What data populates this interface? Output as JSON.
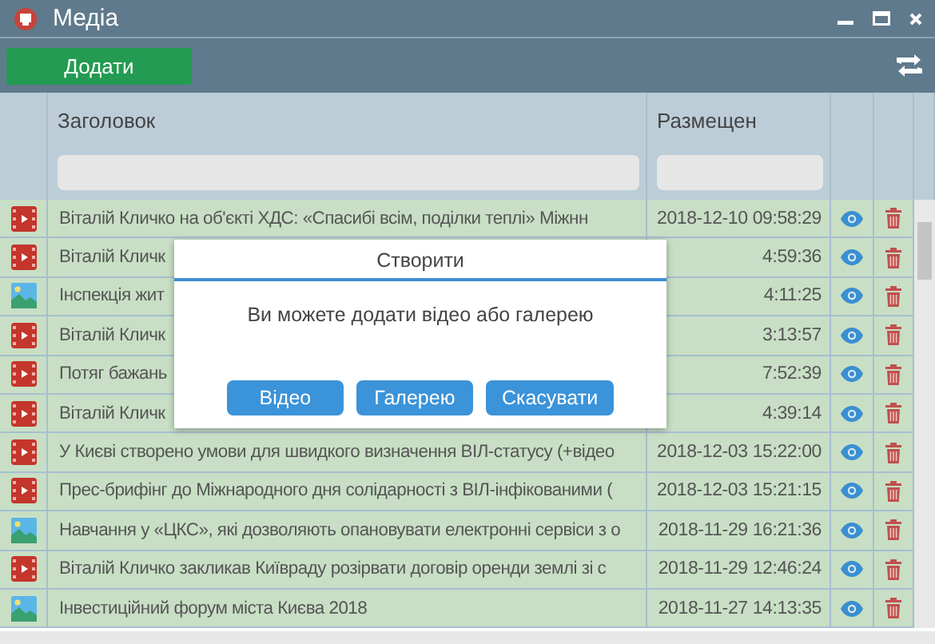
{
  "window": {
    "title": "Медіа"
  },
  "toolbar": {
    "add_button": "Додати"
  },
  "table": {
    "columns": [
      "Заголовок",
      "Размещен"
    ],
    "rows": [
      {
        "kind": "video",
        "title": "Віталій Кличко на об'єкті ХДС: «Спасибі всім, поділки теплі» Міжнн",
        "date": "2018-12-10 09:58:29"
      },
      {
        "kind": "video",
        "title": "Віталій Кличк",
        "date": "4:59:36"
      },
      {
        "kind": "gallery",
        "title": "Інспекція жит",
        "date": "4:11:25"
      },
      {
        "kind": "video",
        "title": "Віталій Кличк",
        "date": "3:13:57"
      },
      {
        "kind": "video",
        "title": "Потяг бажань",
        "date": "7:52:39"
      },
      {
        "kind": "video",
        "title": "Віталій Кличк",
        "date": "4:39:14"
      },
      {
        "kind": "video",
        "title": "У Києві створено умови для швидкого визначення ВІЛ-статусу (+відео",
        "date": "2018-12-03 15:22:00"
      },
      {
        "kind": "video",
        "title": "Прес-брифінг до Міжнародного дня солідарності з ВІЛ-інфікованими (",
        "date": "2018-12-03 15:21:15"
      },
      {
        "kind": "gallery",
        "title": "Навчання у «ЦКС», які дозволяють опановувати електронні сервіси з о",
        "date": "2018-11-29 16:21:36"
      },
      {
        "kind": "video",
        "title": "Віталій Кличко закликав Київраду розірвати договір оренди землі зі с",
        "date": "2018-11-29 12:46:24"
      },
      {
        "kind": "gallery",
        "title": "Інвестиційний форум міста Києва 2018",
        "date": "2018-11-27 14:13:35"
      }
    ]
  },
  "dialog": {
    "title": "Створити",
    "message": "Ви можете додати відео або галерею",
    "buttons": [
      "Відео",
      "Галерею",
      "Скасувати"
    ]
  }
}
